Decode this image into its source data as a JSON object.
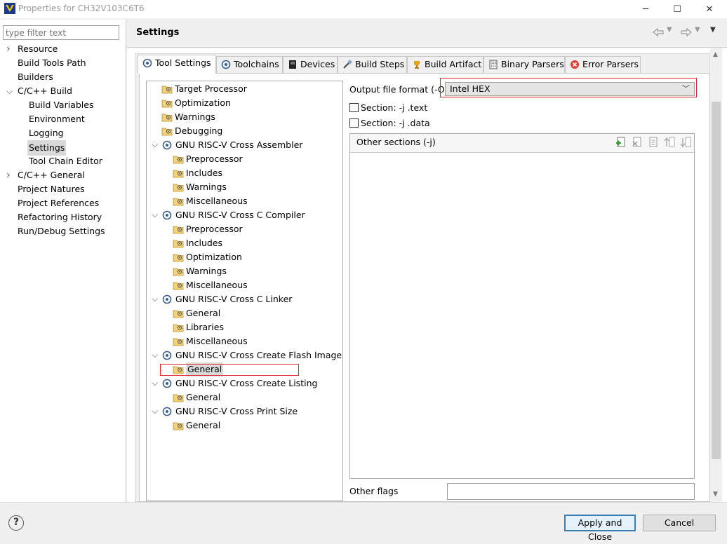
{
  "window": {
    "title": "Properties for CH32V103C6T6",
    "minimize": "─",
    "maximize": "☐",
    "close": "✕"
  },
  "left": {
    "filter_placeholder": "type filter text",
    "items": [
      {
        "label": "Resource",
        "expander": "collapsed"
      },
      {
        "label": "Build Tools Path"
      },
      {
        "label": "Builders"
      },
      {
        "label": "C/C++ Build",
        "expander": "expanded"
      },
      {
        "label": "Build Variables"
      },
      {
        "label": "Environment"
      },
      {
        "label": "Logging"
      },
      {
        "label": "Settings",
        "selected": true
      },
      {
        "label": "Tool Chain Editor"
      },
      {
        "label": "C/C++ General",
        "expander": "collapsed"
      },
      {
        "label": "Project Natures"
      },
      {
        "label": "Project References"
      },
      {
        "label": "Refactoring History"
      },
      {
        "label": "Run/Debug Settings"
      }
    ]
  },
  "header": {
    "title": "Settings",
    "back_icon": "back-arrow-icon",
    "forward_icon": "forward-arrow-icon"
  },
  "tabs": [
    {
      "label": "Tool Settings",
      "icon": "tool-settings-icon",
      "active": true
    },
    {
      "label": "Toolchains",
      "icon": "toolchains-icon"
    },
    {
      "label": "Devices",
      "icon": "devices-icon"
    },
    {
      "label": "Build Steps",
      "icon": "build-steps-icon"
    },
    {
      "label": "Build Artifact",
      "icon": "build-artifact-icon"
    },
    {
      "label": "Binary Parsers",
      "icon": "binary-parsers-icon"
    },
    {
      "label": "Error Parsers",
      "icon": "error-parsers-icon"
    }
  ],
  "tree": [
    {
      "label": "Target Processor",
      "kind": "folder",
      "level": 0
    },
    {
      "label": "Optimization",
      "kind": "folder",
      "level": 0
    },
    {
      "label": "Warnings",
      "kind": "folder",
      "level": 0
    },
    {
      "label": "Debugging",
      "kind": "folder",
      "level": 0
    },
    {
      "label": "GNU RISC-V Cross Assembler",
      "kind": "tool",
      "level": 0
    },
    {
      "label": "Preprocessor",
      "kind": "folder",
      "level": 1
    },
    {
      "label": "Includes",
      "kind": "folder",
      "level": 1
    },
    {
      "label": "Warnings",
      "kind": "folder",
      "level": 1
    },
    {
      "label": "Miscellaneous",
      "kind": "folder",
      "level": 1
    },
    {
      "label": "GNU RISC-V Cross C Compiler",
      "kind": "tool",
      "level": 0
    },
    {
      "label": "Preprocessor",
      "kind": "folder",
      "level": 1
    },
    {
      "label": "Includes",
      "kind": "folder",
      "level": 1
    },
    {
      "label": "Optimization",
      "kind": "folder",
      "level": 1
    },
    {
      "label": "Warnings",
      "kind": "folder",
      "level": 1
    },
    {
      "label": "Miscellaneous",
      "kind": "folder",
      "level": 1
    },
    {
      "label": "GNU RISC-V Cross C Linker",
      "kind": "tool",
      "level": 0
    },
    {
      "label": "General",
      "kind": "folder",
      "level": 1
    },
    {
      "label": "Libraries",
      "kind": "folder",
      "level": 1
    },
    {
      "label": "Miscellaneous",
      "kind": "folder",
      "level": 1
    },
    {
      "label": "GNU RISC-V Cross Create Flash Image",
      "kind": "tool",
      "level": 0
    },
    {
      "label": "General",
      "kind": "folder",
      "level": 1,
      "selected": true
    },
    {
      "label": "GNU RISC-V Cross Create Listing",
      "kind": "tool",
      "level": 0
    },
    {
      "label": "General",
      "kind": "folder",
      "level": 1
    },
    {
      "label": "GNU RISC-V Cross Print Size",
      "kind": "tool",
      "level": 0
    },
    {
      "label": "General",
      "kind": "folder",
      "level": 1
    }
  ],
  "settings": {
    "output_format_label": "Output file format (-O)",
    "output_format_value": "Intel HEX",
    "section_text_label": "Section: -j .text",
    "section_text_checked": false,
    "section_data_label": "Section: -j .data",
    "section_data_checked": false,
    "other_sections_label": "Other sections (-j)",
    "other_sections_tools": [
      "add-icon",
      "delete-icon",
      "edit-icon",
      "move-up-icon",
      "move-down-icon"
    ],
    "other_flags_label": "Other flags",
    "other_flags_value": ""
  },
  "footer": {
    "help_symbol": "?",
    "apply_close": "Apply and Close",
    "cancel": "Cancel"
  },
  "colors": {
    "highlight_red": "#e0242b",
    "selection": "#d9d9d9",
    "default_button_border": "#3c7fb1"
  }
}
